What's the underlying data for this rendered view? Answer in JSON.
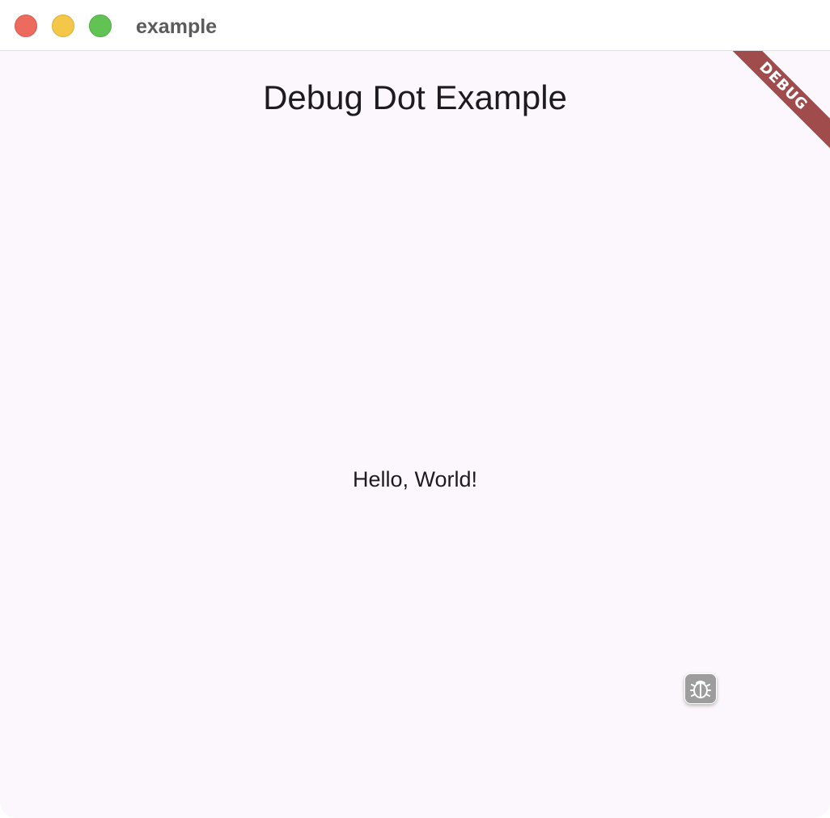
{
  "window": {
    "title": "example"
  },
  "app": {
    "title": "Debug Dot Example",
    "body_text": "Hello, World!",
    "debug_banner": "DEBUG"
  },
  "icons": {
    "close": "close-traffic-light-icon",
    "minimize": "minimize-traffic-light-icon",
    "maximize": "maximize-traffic-light-icon",
    "debug_dot": "bug-icon"
  },
  "colors": {
    "close": "#ed6a5e",
    "minimize": "#f5c748",
    "maximize": "#61c354",
    "background": "#fcf7fc",
    "text": "#1d1b20",
    "banner": "#a04c4c",
    "debug_dot": "#9d9d9d"
  }
}
